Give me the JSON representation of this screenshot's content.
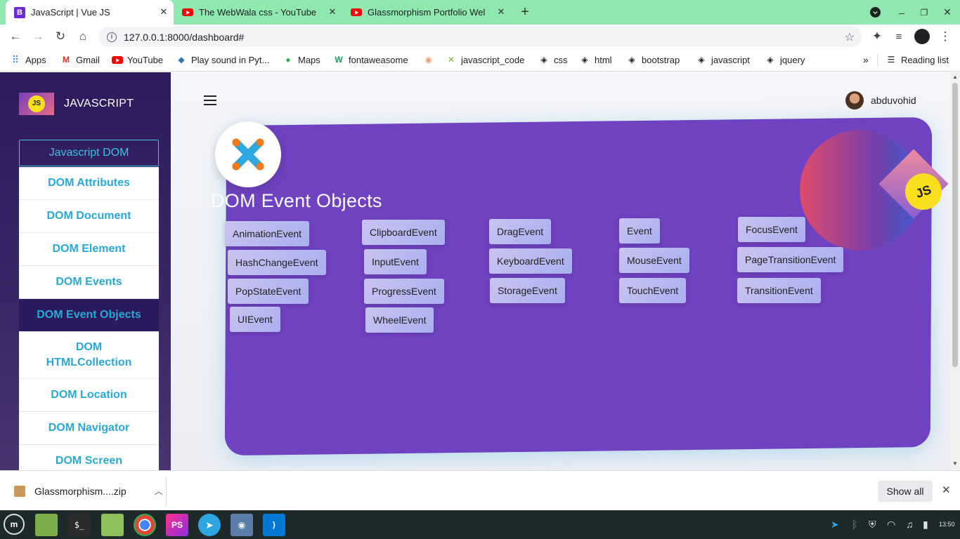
{
  "browser": {
    "tabs": [
      {
        "title": "JavaScript | Vue JS",
        "icon": "bootstrap-icon",
        "active": true
      },
      {
        "title": "The WebWala css - YouTube",
        "icon": "youtube-icon",
        "active": false
      },
      {
        "title": "Glassmorphism Portfolio Wel",
        "icon": "youtube-icon",
        "active": false
      }
    ],
    "url": "127.0.0.1:8000/dashboard#",
    "bookmarks": [
      {
        "label": "Apps",
        "icon": "apps-grid-icon"
      },
      {
        "label": "Gmail",
        "icon": "gmail-icon"
      },
      {
        "label": "YouTube",
        "icon": "youtube-icon"
      },
      {
        "label": "Play sound in Pyt...",
        "icon": "python-icon"
      },
      {
        "label": "Maps",
        "icon": "maps-pin-icon"
      },
      {
        "label": "fontaweasome",
        "icon": "w-logo-icon"
      },
      {
        "label": "",
        "icon": "avatar-icon"
      },
      {
        "label": "javascript_code",
        "icon": "compass-icon"
      },
      {
        "label": "css",
        "icon": "diamond-icon"
      },
      {
        "label": "html",
        "icon": "diamond-icon"
      },
      {
        "label": "bootstrap",
        "icon": "diamond-icon"
      },
      {
        "label": "javascript",
        "icon": "diamond-icon"
      },
      {
        "label": "jquery",
        "icon": "diamond-icon"
      }
    ],
    "reading_list": "Reading list"
  },
  "sidebar": {
    "logo_text": "JS",
    "brand": "JAVASCRIPT",
    "section": "Javascript DOM",
    "items": [
      {
        "label": "DOM Attributes",
        "active": false
      },
      {
        "label": "DOM Document",
        "active": false
      },
      {
        "label": "DOM Element",
        "active": false
      },
      {
        "label": "DOM Events",
        "active": false
      },
      {
        "label": "DOM Event Objects",
        "active": true
      },
      {
        "label": "DOM HTMLCollection",
        "active": false
      },
      {
        "label": "DOM Location",
        "active": false
      },
      {
        "label": "DOM Navigator",
        "active": false
      },
      {
        "label": "DOM Screen",
        "active": false
      }
    ]
  },
  "header": {
    "username": "abduvohid"
  },
  "card": {
    "title": "DOM Event Objects",
    "badge": "JS",
    "events": [
      "AnimationEvent",
      "ClipboardEvent",
      "DragEvent",
      "Event",
      "FocusEvent",
      "HashChangeEvent",
      "InputEvent",
      "KeyboardEvent",
      "MouseEvent",
      "PageTransitionEvent",
      "PopStateEvent",
      "ProgressEvent",
      "StorageEvent",
      "TouchEvent",
      "TransitionEvent",
      "UIEvent",
      "WheelEvent"
    ]
  },
  "downloads": {
    "file": "Glassmorphism....zip",
    "show_all": "Show all"
  },
  "taskbar": {
    "phpstorm_label": "PS",
    "clock": "13:50"
  },
  "colors": {
    "tab_bar": "#8ee8b0",
    "card": "#6f42c1",
    "sidebar": "#2d1b5e",
    "accent": "#2aa8d4"
  }
}
